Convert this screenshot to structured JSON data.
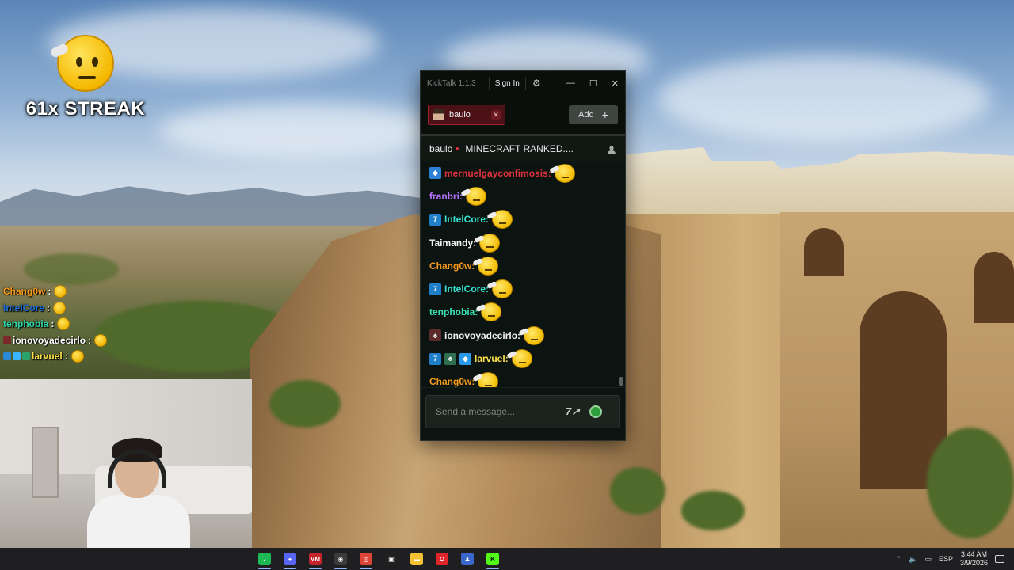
{
  "streak": {
    "label": "61x STREAK"
  },
  "overlay_chat": [
    {
      "user": "Chang0w",
      "color": "#f59a1a",
      "badges": []
    },
    {
      "user": "IntelCore",
      "color": "#1f6fd6",
      "badges": []
    },
    {
      "user": "tenphobia",
      "color": "#2fd7a8",
      "badges": []
    },
    {
      "user": "ionovoyadecirlo",
      "color": "#ffffff",
      "badges": [
        "#7a2a2a"
      ]
    },
    {
      "user": "larvuel",
      "color": "#ffe14a",
      "badges": [
        "#2a8ad8",
        "#38b6ff",
        "#29a36a"
      ]
    }
  ],
  "kicktalk": {
    "app_title": "KickTalk 1.1.3",
    "sign_in": "Sign In",
    "tab": {
      "label": "baulo"
    },
    "add_label": "Add",
    "channel": "baulo",
    "stream_title": "MINECRAFT RANKED....",
    "input_placeholder": "Send a message...",
    "emote_7tv": "7↗",
    "messages": [
      {
        "user": "mernuelgayconfimosis:",
        "color": "#e0323c",
        "badges": [
          {
            "color": "#2c7fd1",
            "glyph": "◆"
          }
        ]
      },
      {
        "user": "franbri:",
        "color": "#b774ff",
        "badges": []
      },
      {
        "user": "IntelCore:",
        "color": "#38e0d0",
        "badges": [
          {
            "color": "#1f7fc8",
            "glyph": "7"
          }
        ]
      },
      {
        "user": "Taimandy:",
        "color": "#f2f2f2",
        "badges": []
      },
      {
        "user": "Chang0w:",
        "color": "#f59a1a",
        "badges": []
      },
      {
        "user": "IntelCore:",
        "color": "#38e0d0",
        "badges": [
          {
            "color": "#1f7fc8",
            "glyph": "7"
          }
        ]
      },
      {
        "user": "tenphobia:",
        "color": "#39e0b2",
        "badges": []
      },
      {
        "user": "ionovoyadecirlo:",
        "color": "#f2f2f2",
        "badges": [
          {
            "color": "#5b2b2b",
            "glyph": "♣"
          }
        ]
      },
      {
        "user": "larvuel:",
        "color": "#ffe14a",
        "badges": [
          {
            "color": "#1f7fc8",
            "glyph": "7"
          },
          {
            "color": "#2f6f4f",
            "glyph": "♣"
          },
          {
            "color": "#2a98e8",
            "glyph": "◆"
          }
        ]
      },
      {
        "user": "Chang0w:",
        "color": "#f59a1a",
        "badges": []
      }
    ]
  },
  "taskbar": {
    "apps": [
      {
        "name": "spotify-icon",
        "color": "#1db954",
        "glyph": "♪"
      },
      {
        "name": "discord-icon",
        "color": "#5865f2",
        "glyph": "●"
      },
      {
        "name": "voicemeeter-icon",
        "color": "#c4242b",
        "glyph": "VM"
      },
      {
        "name": "obs-icon",
        "color": "#3a3a3a",
        "glyph": "◉"
      },
      {
        "name": "chrome-icon",
        "color": "#db4437",
        "glyph": "◎"
      },
      {
        "name": "app-icon",
        "color": "#202020",
        "glyph": "▣"
      },
      {
        "name": "file-explorer-icon",
        "color": "#f2c232",
        "glyph": "▬"
      },
      {
        "name": "opera-icon",
        "color": "#e0262b",
        "glyph": "O"
      },
      {
        "name": "game-icon",
        "color": "#3a67c9",
        "glyph": "♟"
      },
      {
        "name": "kick-icon",
        "color": "#53fc18",
        "glyph": "K"
      }
    ],
    "language": "ESP",
    "time": "3:44 AM",
    "date": "3/9/2026"
  }
}
